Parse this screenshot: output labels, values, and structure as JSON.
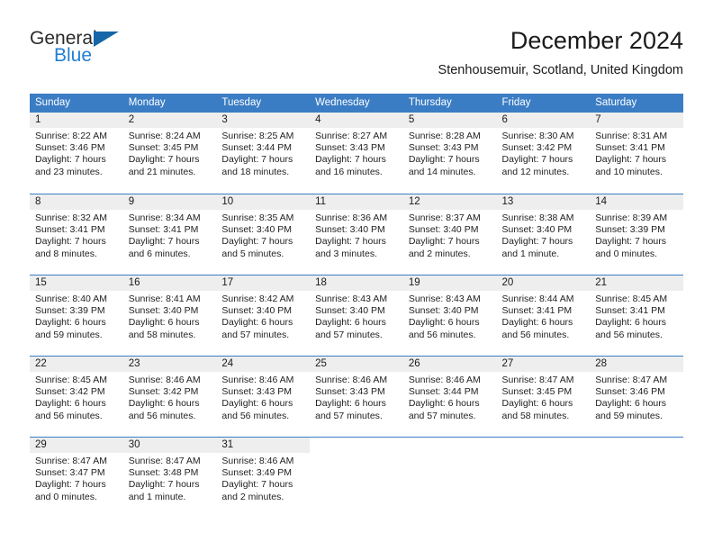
{
  "brand": {
    "name_part1": "General",
    "name_part2": "Blue"
  },
  "header": {
    "month_title": "December 2024",
    "location": "Stenhousemuir, Scotland, United Kingdom"
  },
  "colors": {
    "header_blue": "#3b7dc4",
    "day_band_gray": "#eeeeee",
    "brand_blue": "#1f7fd4",
    "logo_triangle": "#1565a8"
  },
  "weekdays": [
    "Sunday",
    "Monday",
    "Tuesday",
    "Wednesday",
    "Thursday",
    "Friday",
    "Saturday"
  ],
  "weeks": [
    [
      {
        "day": "1",
        "sunrise": "Sunrise: 8:22 AM",
        "sunset": "Sunset: 3:46 PM",
        "daylight_line1": "Daylight: 7 hours",
        "daylight_line2": "and 23 minutes."
      },
      {
        "day": "2",
        "sunrise": "Sunrise: 8:24 AM",
        "sunset": "Sunset: 3:45 PM",
        "daylight_line1": "Daylight: 7 hours",
        "daylight_line2": "and 21 minutes."
      },
      {
        "day": "3",
        "sunrise": "Sunrise: 8:25 AM",
        "sunset": "Sunset: 3:44 PM",
        "daylight_line1": "Daylight: 7 hours",
        "daylight_line2": "and 18 minutes."
      },
      {
        "day": "4",
        "sunrise": "Sunrise: 8:27 AM",
        "sunset": "Sunset: 3:43 PM",
        "daylight_line1": "Daylight: 7 hours",
        "daylight_line2": "and 16 minutes."
      },
      {
        "day": "5",
        "sunrise": "Sunrise: 8:28 AM",
        "sunset": "Sunset: 3:43 PM",
        "daylight_line1": "Daylight: 7 hours",
        "daylight_line2": "and 14 minutes."
      },
      {
        "day": "6",
        "sunrise": "Sunrise: 8:30 AM",
        "sunset": "Sunset: 3:42 PM",
        "daylight_line1": "Daylight: 7 hours",
        "daylight_line2": "and 12 minutes."
      },
      {
        "day": "7",
        "sunrise": "Sunrise: 8:31 AM",
        "sunset": "Sunset: 3:41 PM",
        "daylight_line1": "Daylight: 7 hours",
        "daylight_line2": "and 10 minutes."
      }
    ],
    [
      {
        "day": "8",
        "sunrise": "Sunrise: 8:32 AM",
        "sunset": "Sunset: 3:41 PM",
        "daylight_line1": "Daylight: 7 hours",
        "daylight_line2": "and 8 minutes."
      },
      {
        "day": "9",
        "sunrise": "Sunrise: 8:34 AM",
        "sunset": "Sunset: 3:41 PM",
        "daylight_line1": "Daylight: 7 hours",
        "daylight_line2": "and 6 minutes."
      },
      {
        "day": "10",
        "sunrise": "Sunrise: 8:35 AM",
        "sunset": "Sunset: 3:40 PM",
        "daylight_line1": "Daylight: 7 hours",
        "daylight_line2": "and 5 minutes."
      },
      {
        "day": "11",
        "sunrise": "Sunrise: 8:36 AM",
        "sunset": "Sunset: 3:40 PM",
        "daylight_line1": "Daylight: 7 hours",
        "daylight_line2": "and 3 minutes."
      },
      {
        "day": "12",
        "sunrise": "Sunrise: 8:37 AM",
        "sunset": "Sunset: 3:40 PM",
        "daylight_line1": "Daylight: 7 hours",
        "daylight_line2": "and 2 minutes."
      },
      {
        "day": "13",
        "sunrise": "Sunrise: 8:38 AM",
        "sunset": "Sunset: 3:40 PM",
        "daylight_line1": "Daylight: 7 hours",
        "daylight_line2": "and 1 minute."
      },
      {
        "day": "14",
        "sunrise": "Sunrise: 8:39 AM",
        "sunset": "Sunset: 3:39 PM",
        "daylight_line1": "Daylight: 7 hours",
        "daylight_line2": "and 0 minutes."
      }
    ],
    [
      {
        "day": "15",
        "sunrise": "Sunrise: 8:40 AM",
        "sunset": "Sunset: 3:39 PM",
        "daylight_line1": "Daylight: 6 hours",
        "daylight_line2": "and 59 minutes."
      },
      {
        "day": "16",
        "sunrise": "Sunrise: 8:41 AM",
        "sunset": "Sunset: 3:40 PM",
        "daylight_line1": "Daylight: 6 hours",
        "daylight_line2": "and 58 minutes."
      },
      {
        "day": "17",
        "sunrise": "Sunrise: 8:42 AM",
        "sunset": "Sunset: 3:40 PM",
        "daylight_line1": "Daylight: 6 hours",
        "daylight_line2": "and 57 minutes."
      },
      {
        "day": "18",
        "sunrise": "Sunrise: 8:43 AM",
        "sunset": "Sunset: 3:40 PM",
        "daylight_line1": "Daylight: 6 hours",
        "daylight_line2": "and 57 minutes."
      },
      {
        "day": "19",
        "sunrise": "Sunrise: 8:43 AM",
        "sunset": "Sunset: 3:40 PM",
        "daylight_line1": "Daylight: 6 hours",
        "daylight_line2": "and 56 minutes."
      },
      {
        "day": "20",
        "sunrise": "Sunrise: 8:44 AM",
        "sunset": "Sunset: 3:41 PM",
        "daylight_line1": "Daylight: 6 hours",
        "daylight_line2": "and 56 minutes."
      },
      {
        "day": "21",
        "sunrise": "Sunrise: 8:45 AM",
        "sunset": "Sunset: 3:41 PM",
        "daylight_line1": "Daylight: 6 hours",
        "daylight_line2": "and 56 minutes."
      }
    ],
    [
      {
        "day": "22",
        "sunrise": "Sunrise: 8:45 AM",
        "sunset": "Sunset: 3:42 PM",
        "daylight_line1": "Daylight: 6 hours",
        "daylight_line2": "and 56 minutes."
      },
      {
        "day": "23",
        "sunrise": "Sunrise: 8:46 AM",
        "sunset": "Sunset: 3:42 PM",
        "daylight_line1": "Daylight: 6 hours",
        "daylight_line2": "and 56 minutes."
      },
      {
        "day": "24",
        "sunrise": "Sunrise: 8:46 AM",
        "sunset": "Sunset: 3:43 PM",
        "daylight_line1": "Daylight: 6 hours",
        "daylight_line2": "and 56 minutes."
      },
      {
        "day": "25",
        "sunrise": "Sunrise: 8:46 AM",
        "sunset": "Sunset: 3:43 PM",
        "daylight_line1": "Daylight: 6 hours",
        "daylight_line2": "and 57 minutes."
      },
      {
        "day": "26",
        "sunrise": "Sunrise: 8:46 AM",
        "sunset": "Sunset: 3:44 PM",
        "daylight_line1": "Daylight: 6 hours",
        "daylight_line2": "and 57 minutes."
      },
      {
        "day": "27",
        "sunrise": "Sunrise: 8:47 AM",
        "sunset": "Sunset: 3:45 PM",
        "daylight_line1": "Daylight: 6 hours",
        "daylight_line2": "and 58 minutes."
      },
      {
        "day": "28",
        "sunrise": "Sunrise: 8:47 AM",
        "sunset": "Sunset: 3:46 PM",
        "daylight_line1": "Daylight: 6 hours",
        "daylight_line2": "and 59 minutes."
      }
    ],
    [
      {
        "day": "29",
        "sunrise": "Sunrise: 8:47 AM",
        "sunset": "Sunset: 3:47 PM",
        "daylight_line1": "Daylight: 7 hours",
        "daylight_line2": "and 0 minutes."
      },
      {
        "day": "30",
        "sunrise": "Sunrise: 8:47 AM",
        "sunset": "Sunset: 3:48 PM",
        "daylight_line1": "Daylight: 7 hours",
        "daylight_line2": "and 1 minute."
      },
      {
        "day": "31",
        "sunrise": "Sunrise: 8:46 AM",
        "sunset": "Sunset: 3:49 PM",
        "daylight_line1": "Daylight: 7 hours",
        "daylight_line2": "and 2 minutes."
      },
      {
        "day": "",
        "sunrise": "",
        "sunset": "",
        "daylight_line1": "",
        "daylight_line2": ""
      },
      {
        "day": "",
        "sunrise": "",
        "sunset": "",
        "daylight_line1": "",
        "daylight_line2": ""
      },
      {
        "day": "",
        "sunrise": "",
        "sunset": "",
        "daylight_line1": "",
        "daylight_line2": ""
      },
      {
        "day": "",
        "sunrise": "",
        "sunset": "",
        "daylight_line1": "",
        "daylight_line2": ""
      }
    ]
  ]
}
